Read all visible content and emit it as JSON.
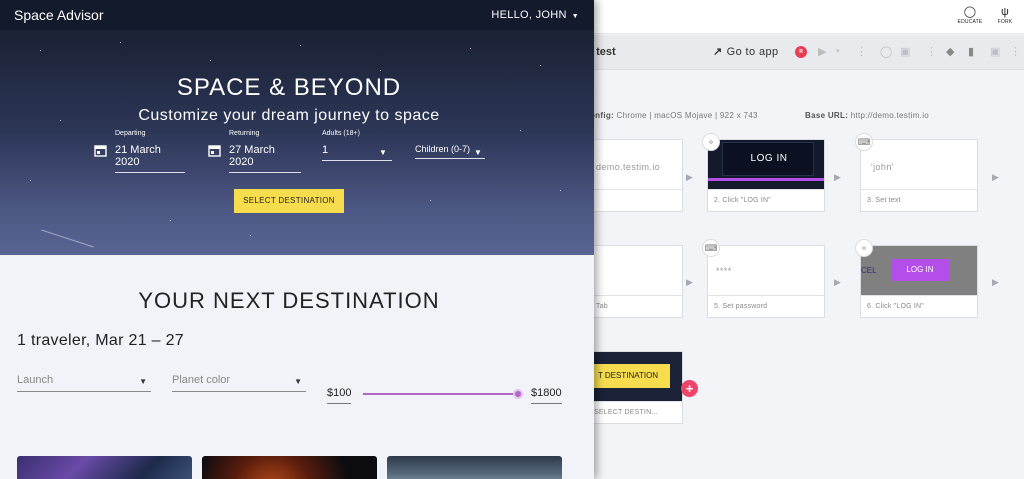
{
  "editor": {
    "topbar": {
      "educate_label": "EDUCATE",
      "fork_label": "FORK"
    },
    "toolbar": {
      "test_name": "l test",
      "goto_app": "Go to app",
      "record_badge": "R"
    },
    "config": {
      "label": "onfig:",
      "value": "Chrome | macOS Mojave | 922 x 743",
      "base_url_label": "Base URL:",
      "base_url_value": "http://demo.testim.io"
    },
    "steps": [
      {
        "thumb_text": "demo.testim.io",
        "caption": ""
      },
      {
        "thumb_text": "LOG IN",
        "caption": "2. Click \"LOG IN\""
      },
      {
        "thumb_text": "'john'",
        "caption": "3. Set text"
      },
      {
        "thumb_text": "",
        "caption": "Tab"
      },
      {
        "thumb_text": "****",
        "caption": "5. Set password"
      },
      {
        "thumb_text": "LOG IN",
        "thumb_prefix": "CEL",
        "caption": "6. Click \"LOG IN\""
      },
      {
        "thumb_text": "T DESTINATION",
        "caption": "SELECT DESTIN..."
      }
    ],
    "add_step": "+",
    "colors": {
      "accent_pink": "#f0456b",
      "purple": "#b34ee8",
      "yellow": "#f7dd4e"
    }
  },
  "app": {
    "brand": "Space Advisor",
    "user_menu": "HELLO, JOHN",
    "hero": {
      "title": "SPACE & BEYOND",
      "subtitle": "Customize your dream journey to space",
      "departing_label": "Departing",
      "departing_value": "21 March 2020",
      "returning_label": "Returning",
      "returning_value": "27 March 2020",
      "adults_label": "Adults (18+)",
      "adults_value": "1",
      "children_label": "Children (0-7)",
      "cta": "SELECT DESTINATION"
    },
    "destinations": {
      "title": "YOUR NEXT DESTINATION",
      "summary": "1 traveler, Mar 21 – 27",
      "launch_placeholder": "Launch",
      "planet_color_placeholder": "Planet color",
      "price_min": "$100",
      "price_max": "$1800",
      "price_slider_value": 1.0
    },
    "colors": {
      "header_bg": "#121a2c",
      "cta": "#f7dd4e",
      "slider": "#b366c8"
    }
  }
}
